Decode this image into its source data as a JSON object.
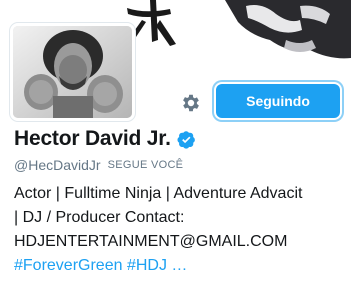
{
  "profile": {
    "display_name": "Hector David Jr.",
    "verified_icon": "verified-badge-icon",
    "handle": "@HecDavidJr",
    "follows_you": "SEGUE VOCÊ",
    "avatar_icon": "profile-photo"
  },
  "actions": {
    "settings_icon": "gear-icon",
    "follow_label": "Seguindo"
  },
  "bio": {
    "line1": "Actor | Fulltime Ninja | Adventure Advacit",
    "line2": "| DJ / Producer Contact:",
    "line3": "HDJENTERTAINMENT@GMAIL.COM",
    "hashtag1": "#ForeverGreen",
    "hashtag2": "#HDJ",
    "ellipsis": "…"
  },
  "colors": {
    "accent": "#1da1f2",
    "text": "#14171a",
    "muted": "#657786"
  }
}
